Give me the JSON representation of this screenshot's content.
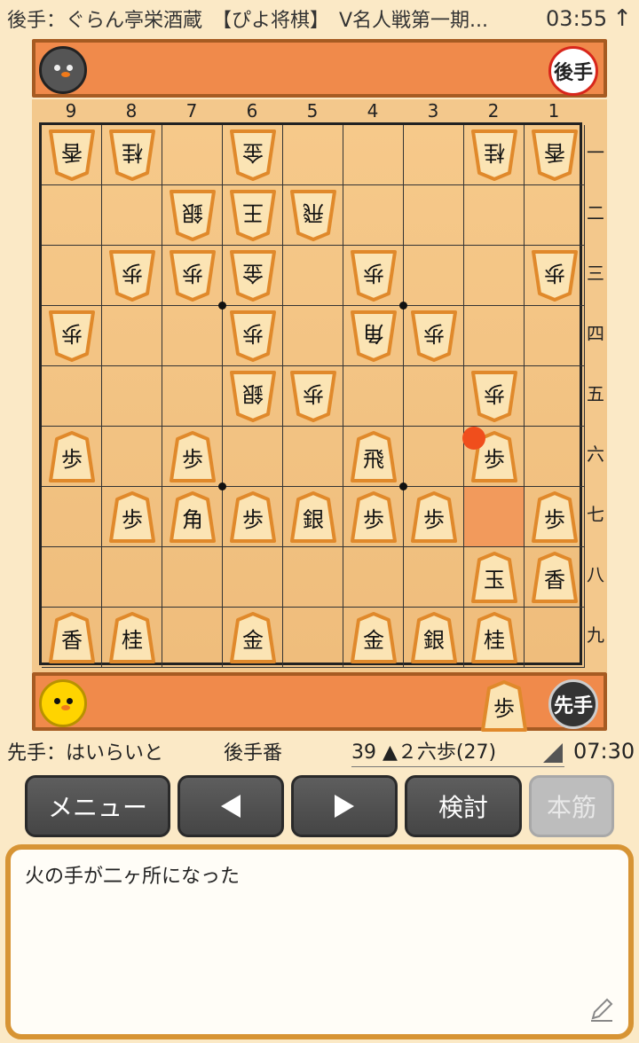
{
  "title_bar": {
    "title": "後手：ぐらん亭栄酒蔵　【ぴよ将棋】　V名人戦第一期...",
    "time": "03:55"
  },
  "gote": {
    "badge": "後手"
  },
  "sente": {
    "badge": "先手",
    "hand_pieces": [
      "歩"
    ]
  },
  "board": {
    "files": [
      "9",
      "8",
      "7",
      "6",
      "5",
      "4",
      "3",
      "2",
      "1"
    ],
    "ranks": [
      "一",
      "二",
      "三",
      "四",
      "五",
      "六",
      "七",
      "八",
      "九"
    ],
    "last_move_square": [
      2,
      7
    ],
    "pieces": [
      {
        "f": 9,
        "r": 1,
        "k": "香",
        "owner": "gote"
      },
      {
        "f": 8,
        "r": 1,
        "k": "桂",
        "owner": "gote"
      },
      {
        "f": 6,
        "r": 1,
        "k": "金",
        "owner": "gote"
      },
      {
        "f": 2,
        "r": 1,
        "k": "桂",
        "owner": "gote"
      },
      {
        "f": 1,
        "r": 1,
        "k": "香",
        "owner": "gote"
      },
      {
        "f": 7,
        "r": 2,
        "k": "銀",
        "owner": "gote"
      },
      {
        "f": 6,
        "r": 2,
        "k": "王",
        "owner": "gote"
      },
      {
        "f": 5,
        "r": 2,
        "k": "飛",
        "owner": "gote"
      },
      {
        "f": 8,
        "r": 3,
        "k": "歩",
        "owner": "gote"
      },
      {
        "f": 7,
        "r": 3,
        "k": "歩",
        "owner": "gote"
      },
      {
        "f": 6,
        "r": 3,
        "k": "金",
        "owner": "gote"
      },
      {
        "f": 4,
        "r": 3,
        "k": "歩",
        "owner": "gote"
      },
      {
        "f": 1,
        "r": 3,
        "k": "歩",
        "owner": "gote"
      },
      {
        "f": 9,
        "r": 4,
        "k": "歩",
        "owner": "gote"
      },
      {
        "f": 6,
        "r": 4,
        "k": "歩",
        "owner": "gote"
      },
      {
        "f": 4,
        "r": 4,
        "k": "角",
        "owner": "gote"
      },
      {
        "f": 3,
        "r": 4,
        "k": "歩",
        "owner": "gote"
      },
      {
        "f": 6,
        "r": 5,
        "k": "銀",
        "owner": "gote"
      },
      {
        "f": 5,
        "r": 5,
        "k": "歩",
        "owner": "gote"
      },
      {
        "f": 2,
        "r": 5,
        "k": "歩",
        "owner": "gote"
      },
      {
        "f": 9,
        "r": 6,
        "k": "歩",
        "owner": "sente"
      },
      {
        "f": 7,
        "r": 6,
        "k": "歩",
        "owner": "sente"
      },
      {
        "f": 4,
        "r": 6,
        "k": "飛",
        "owner": "sente"
      },
      {
        "f": 2,
        "r": 6,
        "k": "歩",
        "owner": "sente"
      },
      {
        "f": 8,
        "r": 7,
        "k": "歩",
        "owner": "sente"
      },
      {
        "f": 7,
        "r": 7,
        "k": "角",
        "owner": "sente"
      },
      {
        "f": 6,
        "r": 7,
        "k": "歩",
        "owner": "sente"
      },
      {
        "f": 5,
        "r": 7,
        "k": "銀",
        "owner": "sente"
      },
      {
        "f": 4,
        "r": 7,
        "k": "歩",
        "owner": "sente"
      },
      {
        "f": 3,
        "r": 7,
        "k": "歩",
        "owner": "sente"
      },
      {
        "f": 1,
        "r": 7,
        "k": "歩",
        "owner": "sente"
      },
      {
        "f": 2,
        "r": 8,
        "k": "玉",
        "owner": "sente"
      },
      {
        "f": 1,
        "r": 8,
        "k": "香",
        "owner": "sente"
      },
      {
        "f": 9,
        "r": 9,
        "k": "香",
        "owner": "sente"
      },
      {
        "f": 8,
        "r": 9,
        "k": "桂",
        "owner": "sente"
      },
      {
        "f": 6,
        "r": 9,
        "k": "金",
        "owner": "sente"
      },
      {
        "f": 4,
        "r": 9,
        "k": "金",
        "owner": "sente"
      },
      {
        "f": 3,
        "r": 9,
        "k": "銀",
        "owner": "sente"
      },
      {
        "f": 2,
        "r": 9,
        "k": "桂",
        "owner": "sente"
      }
    ]
  },
  "info": {
    "sente_name": "先手：はいらいと",
    "turn": "後手番",
    "last_move": "39 ▲２六歩(27)",
    "time": "07:30"
  },
  "buttons": {
    "menu": "メニュー",
    "prev": "◀",
    "next": "▶",
    "analyze": "検討",
    "mainline": "本筋"
  },
  "comment": "火の手が二ヶ所になった",
  "colors": {
    "hand_bar": "#f08a4b",
    "board": "#f3c88c",
    "last_move_cell": "#f29a5c",
    "last_move_dot": "#f04e1c",
    "comment_border": "#d79434"
  }
}
